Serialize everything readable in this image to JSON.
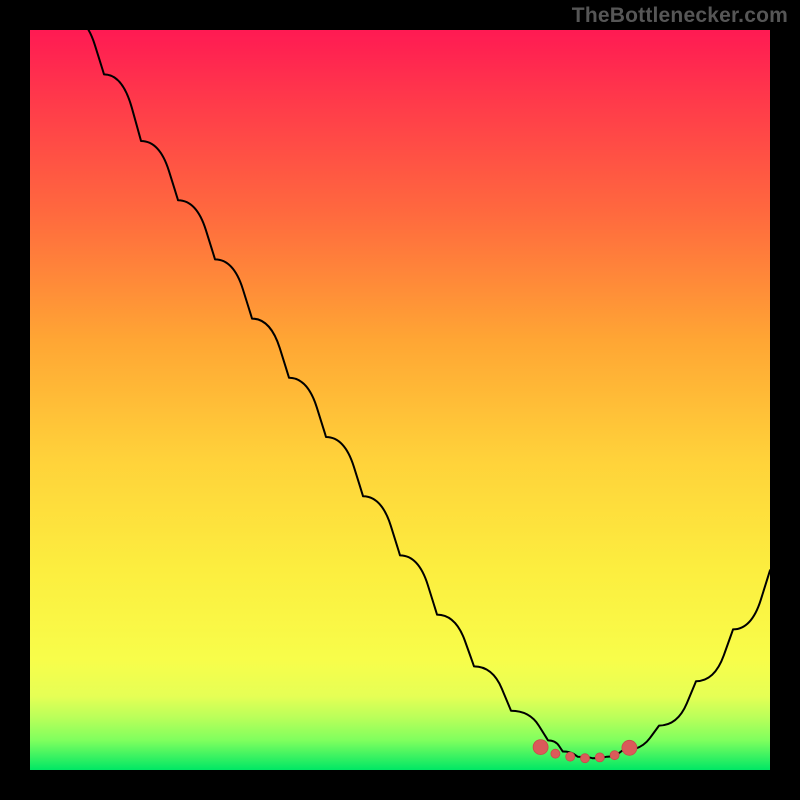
{
  "attribution_text": "TheBottlenecker.com",
  "chart_data": {
    "type": "line",
    "title": "",
    "xlabel": "",
    "ylabel": "",
    "xlim": [
      0,
      100
    ],
    "ylim": [
      0,
      100
    ],
    "series": [
      {
        "name": "bottleneck-curve",
        "x": [
          5,
          10,
          15,
          20,
          25,
          30,
          35,
          40,
          45,
          50,
          55,
          60,
          65,
          70,
          72,
          74,
          76,
          78,
          80,
          85,
          90,
          95,
          100
        ],
        "values": [
          102,
          94,
          85,
          77,
          69,
          61,
          53,
          45,
          37,
          29,
          21,
          14,
          8,
          4,
          2.5,
          1.8,
          1.6,
          1.8,
          2.6,
          6,
          12,
          19,
          27
        ]
      }
    ],
    "markers": {
      "name": "optimal-range",
      "x": [
        69,
        71,
        73,
        75,
        77,
        79,
        81
      ],
      "values": [
        3.1,
        2.2,
        1.8,
        1.6,
        1.7,
        2.0,
        3.0
      ]
    },
    "grid": false,
    "legend": null
  }
}
